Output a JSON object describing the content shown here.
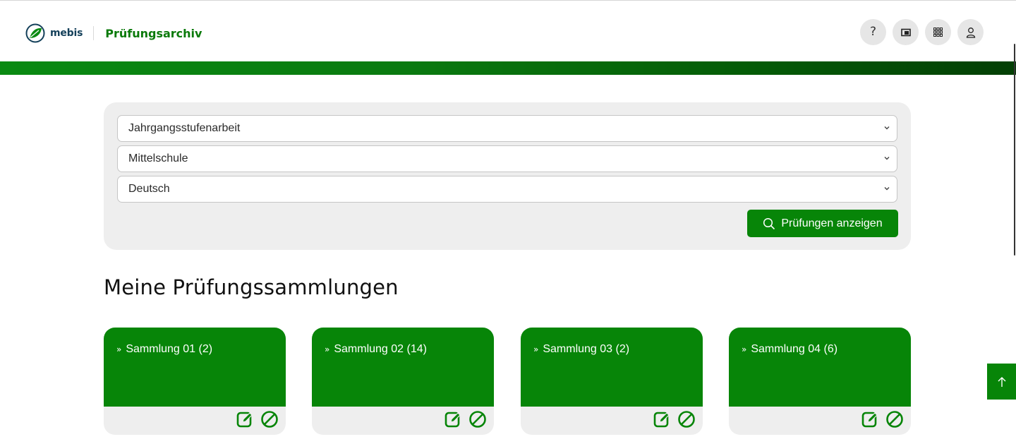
{
  "header": {
    "brand_name": "mebis",
    "app_title": "Prüfungsarchiv",
    "icons": [
      "help-icon",
      "folder-icon",
      "apps-grid-icon",
      "user-icon"
    ]
  },
  "filters": {
    "exam_type": {
      "selected": "Jahrgangsstufenarbeit"
    },
    "school_type": {
      "selected": "Mittelschule"
    },
    "subject": {
      "selected": "Deutsch"
    },
    "submit_label": "Prüfungen anzeigen"
  },
  "collections": {
    "title": "Meine Prüfungssammlungen",
    "items": [
      {
        "label": "Sammlung 01 (2)"
      },
      {
        "label": "Sammlung 02 (14)"
      },
      {
        "label": "Sammlung 03 (2)"
      },
      {
        "label": "Sammlung 04 (6)"
      }
    ]
  },
  "colors": {
    "primary_green": "#078508",
    "panel_bg": "#eeeeee",
    "brand_blue": "#14405a"
  }
}
